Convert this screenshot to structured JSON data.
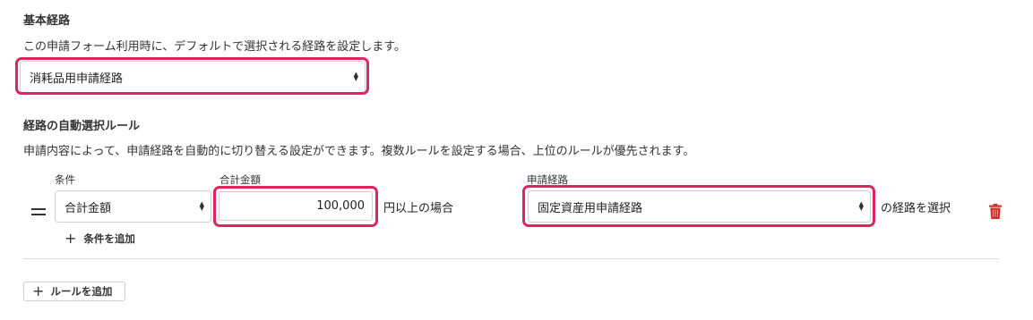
{
  "default_route": {
    "title": "基本経路",
    "description": "この申請フォーム利用時に、デフォルトで選択される経路を設定します。",
    "selected": "消耗品用申請経路"
  },
  "auto_rules": {
    "title": "経路の自動選択ルール",
    "description": "申請内容によって、申請経路を自動的に切り替える設定ができます。複数ルールを設定する場合、上位のルールが優先されます。",
    "rule": {
      "condition_label": "条件",
      "condition_value": "合計金額",
      "amount_label": "合計金額",
      "amount_value": "100,000",
      "amount_suffix": "円以上の場合",
      "route_label": "申請経路",
      "route_value": "固定資産用申請経路",
      "route_suffix": "の経路を選択"
    },
    "add_condition_label": "条件を追加",
    "add_rule_label": "ルールを追加"
  },
  "colors": {
    "highlight": "#e0245e",
    "delete": "#d0302c"
  },
  "icons": [
    "drag-handle-icon",
    "plus-icon",
    "trash-icon",
    "select-arrows-icon"
  ]
}
